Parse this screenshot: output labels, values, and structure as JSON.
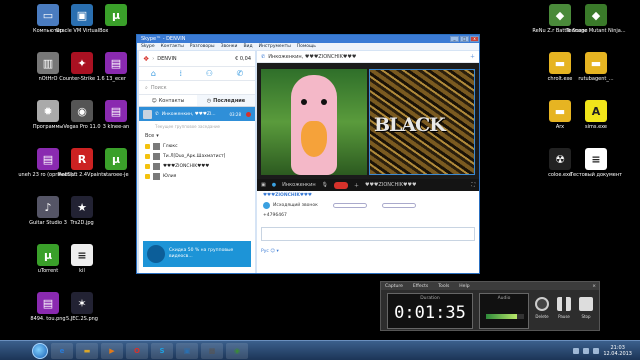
{
  "desktop": {
    "left_icons": [
      {
        "label": "Компьютер",
        "icon": "computer-icon",
        "color": "#4a7cc0",
        "glyph": "▭"
      },
      {
        "label": "Oracle VM VirtualBox",
        "icon": "virtualbox-icon",
        "color": "#2a6fb0",
        "glyph": "▣"
      },
      {
        "label": "",
        "icon": "utorrent-icon",
        "color": "#3aa02a",
        "glyph": "µ"
      },
      {
        "label": "nOtHrO",
        "icon": "folder-photo-icon",
        "color": "#777",
        "glyph": "▥"
      },
      {
        "label": "Counter-Strike 1.6",
        "icon": "counter-strike-icon",
        "color": "#a12",
        "glyph": "✦"
      },
      {
        "label": "13_ecer",
        "icon": "winrar-icon",
        "color": "#8a2ab0",
        "glyph": "▤"
      },
      {
        "label": "Программы",
        "icon": "programs-gear-icon",
        "color": "#aaa",
        "glyph": "✹"
      },
      {
        "label": "Vegas Pro 11.0",
        "icon": "vegas-icon",
        "color": "#555",
        "glyph": "◉"
      },
      {
        "label": "3 klnee-an",
        "icon": "winrar-icon",
        "color": "#8a2ab0",
        "glyph": "▤"
      },
      {
        "label": "uneh 23 ro (oprinalni)...",
        "icon": "winrar-icon",
        "color": "#8a2ab0",
        "glyph": "▤"
      },
      {
        "label": "RedSoft 2.4Vpaints",
        "icon": "redsoft-icon",
        "color": "#c22",
        "glyph": "R"
      },
      {
        "label": "staroee-je",
        "icon": "utorrent-icon",
        "color": "#3aa02a",
        "glyph": "µ"
      },
      {
        "label": "Guitar Studio 3",
        "icon": "guitar-icon",
        "color": "#556",
        "glyph": "♪"
      },
      {
        "label": "Trs2D.jpg",
        "icon": "image-file-icon",
        "color": "#223",
        "glyph": "★"
      },
      {
        "label": "",
        "icon": "",
        "color": "",
        "glyph": ""
      },
      {
        "label": "uTorrent",
        "icon": "utorrent-icon",
        "color": "#3aa02a",
        "glyph": "µ"
      },
      {
        "label": "kil",
        "icon": "text-file-icon",
        "color": "#eee",
        "glyph": "≡"
      },
      {
        "label": "",
        "icon": "",
        "color": "",
        "glyph": ""
      },
      {
        "label": "8494. tou.png",
        "icon": "winrar-icon",
        "color": "#8a2ab0",
        "glyph": "▤"
      },
      {
        "label": "5.JEC.2S.png",
        "icon": "image-file-icon",
        "color": "#223",
        "glyph": "✶"
      }
    ],
    "right_icons": [
      {
        "label": "ReNu Z.r Battle Scene",
        "icon": "game-icon",
        "color": "#4a8a3a",
        "glyph": "◆"
      },
      {
        "label": "Teenage Mutant Ninja...",
        "icon": "game-icon",
        "color": "#3a7a2a",
        "glyph": "◆"
      },
      {
        "label": "chrolt.exe",
        "icon": "folder-icon",
        "color": "#e6b422",
        "glyph": "▬"
      },
      {
        "label": "rutubagent_...",
        "icon": "folder-icon",
        "color": "#e6b422",
        "glyph": "▬"
      },
      {
        "label": "Arx",
        "icon": "folder-icon",
        "color": "#e6b422",
        "glyph": "▬"
      },
      {
        "label": "sims.exe",
        "icon": "font-a-icon",
        "color": "#f1e51a",
        "glyph": "A"
      },
      {
        "label": "coloe.exe",
        "icon": "radiation-icon",
        "color": "#222",
        "glyph": "☢"
      },
      {
        "label": "Тестовый документ",
        "icon": "document-icon",
        "color": "#fff",
        "glyph": "≡"
      }
    ]
  },
  "skype": {
    "title": "Skype™ - DENVIN",
    "menu": [
      "Skype",
      "Контакты",
      "Разговоры",
      "Звонки",
      "Вид",
      "Инструменты",
      "Помощь"
    ],
    "profile_name": "DENVIN",
    "credit": "€ 0,04",
    "search_placeholder": "Поиск",
    "tab_contacts": "Контакты",
    "tab_recent": "Последние",
    "active_chat": {
      "name": "Инкоженкин, ♥♥♥ZI...",
      "time": "03:28"
    },
    "active_chat_sub": "Текущее групповое заседание",
    "group_header": "Все",
    "contacts": [
      {
        "name": "Глюкс"
      },
      {
        "name": "Ти.Л[Duo_Арк.Шахматист]"
      },
      {
        "name": "♥♥♥ZIONCHIK♥♥♥"
      },
      {
        "name": "Юлия"
      }
    ],
    "promo_text": "Скидка 50 % на групповые видеосв...",
    "conv_title": "Инкоженкин, ♥♥♥ZIONCHIK♥♥♥",
    "video_left_name": "Инкоженкин",
    "video_right_name": "♥♥♥ZIONCHIK♥♥♥",
    "video_right_text": "BLACK",
    "chat_sender": "♥♥♥ZIONCHIK♥♥♥",
    "call_label": "Исходящий звонок",
    "call_number": "+4796467",
    "input_placeholder": "",
    "lang": "Рус"
  },
  "recorder": {
    "menu": [
      "Capture",
      "Effects",
      "Tools",
      "Help"
    ],
    "duration_label": "Duration",
    "duration": "0:01:35",
    "audio_label": "Audio",
    "audio_level": 0.82,
    "delete_label": "Delete",
    "pause_label": "Pause",
    "stop_label": "Stop"
  },
  "taskbar": {
    "items": [
      {
        "icon": "ie-icon",
        "color": "#2a7ad5",
        "glyph": "e"
      },
      {
        "icon": "explorer-icon",
        "color": "#d9a62a",
        "glyph": "▬"
      },
      {
        "icon": "media-player-icon",
        "color": "#e07a1a",
        "glyph": "▶"
      },
      {
        "icon": "opera-icon",
        "color": "#d6322b",
        "glyph": "O"
      },
      {
        "icon": "skype-icon",
        "color": "#1fa0e0",
        "glyph": "S"
      },
      {
        "icon": "virtualbox-icon",
        "color": "#2a6fb0",
        "glyph": "▣"
      },
      {
        "icon": "photo-icon",
        "color": "#555",
        "glyph": "▩"
      },
      {
        "icon": "camtasia-icon",
        "color": "#3a8a3a",
        "glyph": "◉"
      }
    ],
    "clock_time": "21:03",
    "clock_date": "12.04.2013"
  }
}
